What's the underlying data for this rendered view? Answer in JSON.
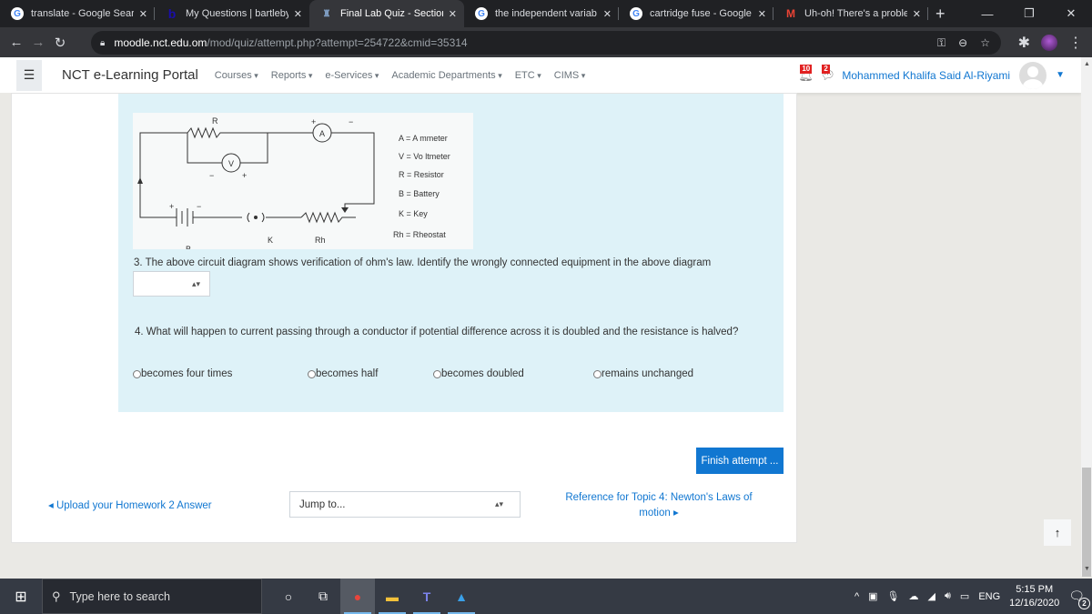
{
  "browser": {
    "tabs": [
      {
        "title": "translate - Google Sear",
        "icon": "google-icon",
        "active": false
      },
      {
        "title": "My Questions | bartleby",
        "icon": "bartleby-icon",
        "active": false
      },
      {
        "title": "Final Lab Quiz - Section",
        "icon": "moodle-icon",
        "active": true
      },
      {
        "title": "the independent variab",
        "icon": "google-icon",
        "active": false
      },
      {
        "title": "cartridge fuse - Google",
        "icon": "google-icon",
        "active": false
      },
      {
        "title": "Uh-oh! There's a proble",
        "icon": "gmail-icon",
        "active": false
      }
    ],
    "url_host": "moodle.nct.edu.om",
    "url_path": "/mod/quiz/attempt.php?attempt=254722&cmid=35314"
  },
  "navbar": {
    "brand": "NCT e-Learning Portal",
    "menu": [
      "Courses",
      "Reports",
      "e-Services",
      "Academic Departments",
      "ETC",
      "CIMS"
    ],
    "notifications_count": "10",
    "messages_count": "2",
    "user_name": "Mohammed Khalifa Said Al-Riyami"
  },
  "diagram": {
    "labels": {
      "R": "R",
      "A": "A",
      "V": "V",
      "K": "K",
      "Rh": "Rh",
      "B": "B"
    },
    "legend": [
      "A = A  mmeter",
      "V =  Vo ltmeter",
      "R = Resistor",
      "B = Battery",
      "K = Key",
      "Rh = Rheostat"
    ]
  },
  "questions": {
    "q3": {
      "text": "3. The above circuit diagram shows verification of ohm's law. Identify the wrongly connected equipment in the above diagram",
      "selected": ""
    },
    "q4": {
      "text": "4. What will happen to current passing through a conductor if potential difference across it is doubled and the resistance is halved?",
      "options": [
        "becomes four times",
        "becomes half",
        "becomes doubled",
        "remains unchanged"
      ]
    }
  },
  "actions": {
    "finish": "Finish attempt ...",
    "prev_link": "Upload your Homework 2 Answer",
    "jump_placeholder": "Jump to...",
    "next_link": "Reference for Topic 4: Newton's Laws of motion"
  },
  "taskbar": {
    "search_placeholder": "Type here to search",
    "language": "ENG",
    "time": "5:15 PM",
    "date": "12/16/2020",
    "notification_count": "2"
  }
}
